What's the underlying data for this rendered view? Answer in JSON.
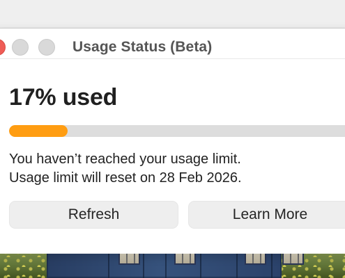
{
  "window": {
    "title": "Usage Status (Beta)"
  },
  "usage": {
    "heading": "17% used",
    "progress_percent": 17,
    "limit_message": "You haven’t reached your usage limit.",
    "reset_message": "Usage limit will reset on 28 Feb 2026."
  },
  "buttons": {
    "refresh": "Refresh",
    "learn_more": "Learn More"
  },
  "colors": {
    "progress_fill": "#ff9d12",
    "progress_track": "#dddddd",
    "close_button": "#ef5c56",
    "inactive_buttons": "#d9d9d9"
  }
}
